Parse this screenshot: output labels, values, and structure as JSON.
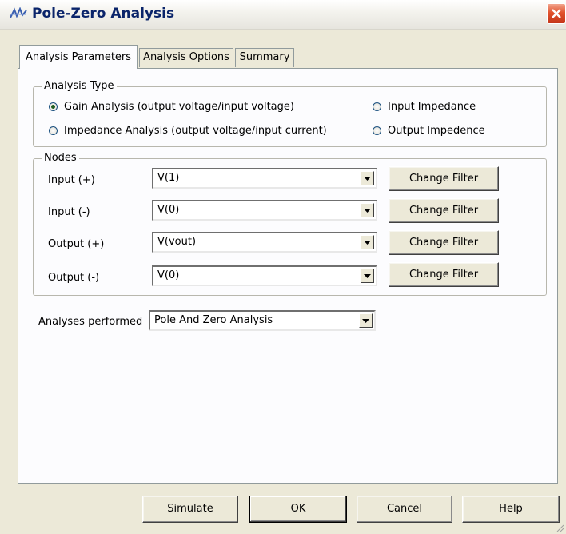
{
  "window": {
    "title": "Pole-Zero Analysis",
    "title_icon": "analysis-wave-icon",
    "close_icon": "close-icon"
  },
  "tabs": [
    {
      "label": "Analysis Parameters",
      "active": true
    },
    {
      "label": "Analysis Options",
      "active": false
    },
    {
      "label": "Summary",
      "active": false
    }
  ],
  "analysis_type": {
    "group_label": "Analysis Type",
    "options": [
      {
        "label": "Gain Analysis (output voltage/input voltage)",
        "checked": true
      },
      {
        "label": "Input Impedance",
        "checked": false
      },
      {
        "label": "Impedance Analysis (output voltage/input current)",
        "checked": false
      },
      {
        "label": "Output Impedence",
        "checked": false
      }
    ]
  },
  "nodes": {
    "group_label": "Nodes",
    "rows": [
      {
        "label": "Input (+)",
        "value": "V(1)",
        "button": "Change Filter"
      },
      {
        "label": "Input (-)",
        "value": "V(0)",
        "button": "Change Filter"
      },
      {
        "label": "Output (+)",
        "value": "V(vout)",
        "button": "Change Filter"
      },
      {
        "label": "Output (-)",
        "value": "V(0)",
        "button": "Change Filter"
      }
    ]
  },
  "analyses_performed": {
    "label": "Analyses performed",
    "value": "Pole And Zero Analysis"
  },
  "footer": {
    "simulate": "Simulate",
    "ok": "OK",
    "cancel": "Cancel",
    "help": "Help"
  }
}
